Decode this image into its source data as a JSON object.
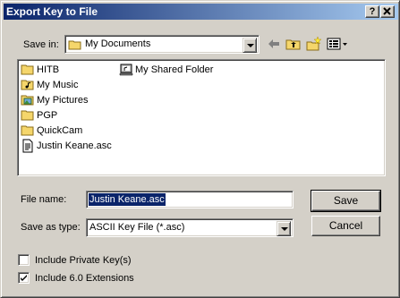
{
  "window": {
    "title": "Export Key to File",
    "help_glyph": "?",
    "close_glyph": "X"
  },
  "save_in": {
    "label": "Save in:",
    "value": "My Documents"
  },
  "toolbar": {
    "icons": [
      "back-arrow-icon",
      "up-one-level-icon",
      "create-new-folder-icon",
      "view-menu-icon"
    ]
  },
  "files": {
    "col1": [
      {
        "name": "HITB",
        "icon": "folder-icon"
      },
      {
        "name": "My Music",
        "icon": "music-folder-icon"
      },
      {
        "name": "My Pictures",
        "icon": "pictures-folder-icon"
      },
      {
        "name": "PGP",
        "icon": "folder-icon"
      },
      {
        "name": "QuickCam",
        "icon": "folder-icon"
      },
      {
        "name": "Justin Keane.asc",
        "icon": "text-file-icon"
      }
    ],
    "col2": [
      {
        "name": "My Shared Folder",
        "icon": "shared-folder-icon"
      }
    ]
  },
  "filename": {
    "label": "File name:",
    "value": "Justin Keane.asc"
  },
  "savetype": {
    "label": "Save as type:",
    "value": "ASCII Key File (*.asc)"
  },
  "buttons": {
    "save": "Save",
    "cancel": "Cancel"
  },
  "options": {
    "include_private": {
      "label": "Include Private Key(s)",
      "checked": false
    },
    "include_60": {
      "label": "Include 6.0 Extensions",
      "checked": true
    }
  },
  "colors": {
    "titlebar_start": "#0a246a",
    "titlebar_end": "#a6caf0",
    "dialog_face": "#d4d0c8",
    "folder_yellow": "#f5d66b",
    "selection": "#0a246a"
  }
}
